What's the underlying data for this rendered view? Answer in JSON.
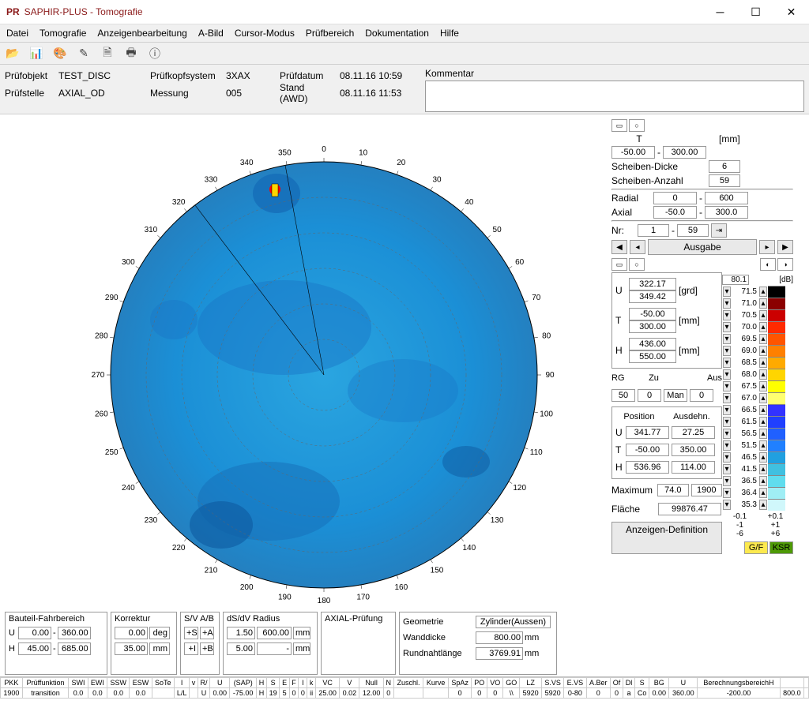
{
  "title": "SAPHIR-PLUS - Tomografie",
  "icon": "PR",
  "menu": [
    "Datei",
    "Tomografie",
    "Anzeigenbearbeitung",
    "A-Bild",
    "Cursor-Modus",
    "Prüfbereich",
    "Dokumentation",
    "Hilfe"
  ],
  "info": {
    "pruefobj_lbl": "Prüfobjekt",
    "pruefobj_val": "TEST_DISC",
    "pruefstelle_lbl": "Prüfstelle",
    "pruefstelle_val": "AXIAL_OD",
    "pkopf_lbl": "Prüfkopfsystem",
    "pkopf_val": "3XAX",
    "messung_lbl": "Messung",
    "messung_val": "005",
    "pruefdatum_lbl": "Prüfdatum",
    "pruefdatum_val": "08.11.16 10:59",
    "stand_lbl": "Stand (AWD)",
    "stand_val": "08.11.16 11:53",
    "komm_lbl": "Kommentar",
    "komm_val": ""
  },
  "sp": {
    "T_lbl": "T",
    "mm_lbl": "[mm]",
    "T_lo": "-50.00",
    "T_hi": "300.00",
    "sd_lbl": "Scheiben-Dicke",
    "sd_val": "6",
    "sa_lbl": "Scheiben-Anzahl",
    "sa_val": "59",
    "rad_lbl": "Radial",
    "rad_lo": "0",
    "rad_hi": "600",
    "ax_lbl": "Axial",
    "ax_lo": "-50.0",
    "ax_hi": "300.0",
    "nr_lbl": "Nr:",
    "nr_lo": "1",
    "nr_hi": "59",
    "ausgabe": "Ausgabe",
    "db": "[dB]",
    "db_top": "80.1",
    "U_lbl": "U",
    "U_lo": "322.17",
    "U_hi": "349.42",
    "grd": "[grd]",
    "T_lbl2": "T",
    "T2_lo": "-50.00",
    "T2_hi": "300.00",
    "mm2": "[mm]",
    "H_lbl": "H",
    "H_lo": "436.00",
    "H_hi": "550.00",
    "mm3": "[mm]",
    "RG": "RG",
    "Zu": "Zu",
    "Aus": "Aus",
    "Man": "Man",
    "rg_v": "50",
    "zu_v": "0",
    "aus_v": "0",
    "pos": "Position",
    "ausd": "Ausdehn.",
    "pU": "U",
    "pU1": "341.77",
    "pU2": "27.25",
    "pT": "T",
    "pT1": "-50.00",
    "pT2": "350.00",
    "pH": "H",
    "pH1": "536.96",
    "pH2": "114.00",
    "max": "Maximum",
    "max1": "74.0",
    "max2": "1900",
    "fl": "Fläche",
    "fl_v": "99876.47",
    "anzdef": "Anzeigen-Definition",
    "scale": [
      "71.5",
      "71.0",
      "70.5",
      "70.0",
      "69.5",
      "69.0",
      "68.5",
      "68.0",
      "67.5",
      "67.0",
      "66.5",
      "61.5",
      "56.5",
      "51.5",
      "46.5",
      "41.5",
      "36.5",
      "36.4",
      "35.3"
    ],
    "colors": [
      "#000000",
      "#8b0000",
      "#cc0000",
      "#ff2a00",
      "#ff5500",
      "#ff8000",
      "#ffaa00",
      "#ffd500",
      "#ffff00",
      "#ffff70",
      "#3232ff",
      "#2040ff",
      "#2060ff",
      "#2080ff",
      "#20a0e0",
      "#40c0e0",
      "#60ddee",
      "#a0eef5",
      "#d0f7fb"
    ],
    "off": [
      "-0.1",
      "+0.1",
      "-1",
      "+1",
      "-6",
      "+6"
    ],
    "gf": "G/F",
    "ksr": "KSR"
  },
  "bottom": {
    "bf_lbl": "Bauteil-Fahrbereich",
    "U": "U",
    "H": "H",
    "bf_u1": "0.00",
    "bf_u2": "360.00",
    "bf_h1": "45.00",
    "bf_h2": "685.00",
    "ko_lbl": "Korrektur",
    "ko_v": "0.00",
    "deg": "deg",
    "ko2": "35.00",
    "mm": "mm",
    "sv_lbl": "S/V A/B",
    "sv_s": "+S",
    "sv_a": "+A",
    "sv_i": "+I",
    "sv_b": "+B",
    "ds_lbl": "dS/dV Radius",
    "ds1": "1.50",
    "ds2": "600.00",
    "ds3": "5.00",
    "ds4": "-",
    "ax_lbl": "AXIAL-Prüfung",
    "geo_lbl": "Geometrie",
    "geo_v": "Zylinder(Aussen)",
    "wd_lbl": "Wanddicke",
    "wd_v": "800.00",
    "wd_u": "mm",
    "rn_lbl": "Rundnahtlänge",
    "rn_v": "3769.91",
    "rn_u": "mm"
  },
  "status": {
    "hdr": [
      "PKK",
      "Prüffunktion",
      "SWI",
      "EWI",
      "SSW",
      "ESW",
      "SoTe",
      "I",
      "v",
      "R/",
      "U",
      "(SAP)",
      "H",
      "S",
      "E",
      "F",
      "I",
      "k",
      "VC",
      "V",
      "Null",
      "N",
      "Zuschl.",
      "Kurve",
      "SpAz",
      "PO",
      "VO",
      "GO",
      "LZ",
      "S.VS",
      "E.VS",
      "A.Ber",
      "Of",
      "Dl",
      "S",
      "BG",
      "U",
      "BerechnungsbereichH",
      "",
      ""
    ],
    "row": [
      "1900",
      "transition",
      "0.0",
      "0.0",
      "0.0",
      "0.0",
      "",
      "L/L",
      "",
      "U",
      "0.00",
      "-75.00",
      "H",
      "19",
      "5",
      "0",
      "0",
      "ii",
      "25.00",
      "0.02",
      "12.00",
      "0",
      "",
      "",
      "0",
      "0",
      "0",
      "\\\\",
      "5920",
      "5920",
      "0-80",
      "0",
      "0",
      "a",
      "Co",
      "0.00",
      "360.00",
      "-200.00",
      "800.0",
      ""
    ]
  },
  "chart_data": {
    "type": "polar-heatmap",
    "title": "Tomografie",
    "angle_ticks": [
      0,
      10,
      20,
      30,
      40,
      50,
      60,
      70,
      80,
      90,
      100,
      110,
      120,
      130,
      140,
      150,
      160,
      170,
      180,
      190,
      200,
      210,
      220,
      230,
      240,
      250,
      260,
      270,
      280,
      290,
      300,
      310,
      320,
      330,
      340,
      350
    ],
    "radial_range": [
      0,
      600
    ],
    "angle_unit": "deg",
    "sector": {
      "from": 322.17,
      "to": 349.42
    },
    "hotspot": {
      "angle": 341.77,
      "radius": 536.96,
      "max_db": 74.0
    }
  }
}
